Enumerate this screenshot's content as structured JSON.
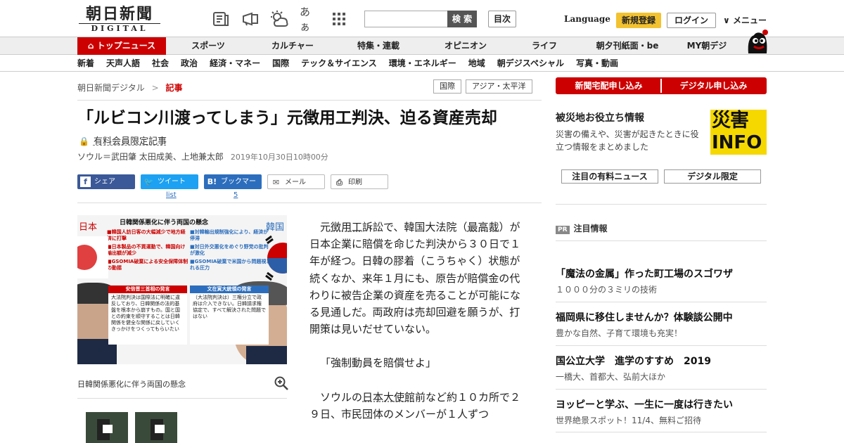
{
  "header": {
    "logo_main": "朝日新聞",
    "logo_sub": "DIGITAL",
    "search_button": "検 索",
    "toc_button": "目次",
    "language": "Language",
    "signup": "新規登録",
    "login": "ログイン",
    "menu": "メニュー",
    "icons": [
      "newspaper-icon",
      "megaphone-icon",
      "weather-icon",
      "font-size-icon",
      "grid-icon"
    ],
    "font_size_glyph": "あぁ"
  },
  "nav_primary": [
    "トップニュース",
    "スポーツ",
    "カルチャー",
    "特集・連載",
    "オピニオン",
    "ライフ",
    "朝夕刊紙面・be",
    "MY朝デジ"
  ],
  "nav_secondary": [
    "新着",
    "天声人語",
    "社会",
    "政治",
    "経済・マネー",
    "国際",
    "テック＆サイエンス",
    "環境・エネルギー",
    "地域",
    "朝デジスペシャル",
    "写真・動画"
  ],
  "breadcrumb": {
    "home": "朝日新聞デジタル",
    "sep": ">",
    "current": "記事"
  },
  "tags": [
    "国際",
    "アジア・太平洋"
  ],
  "article": {
    "headline": "「ルビコン川渡ってしまう」元徴用工判決、迫る資産売却",
    "members_only": "有料会員限定記事",
    "authors": "ソウル＝武田肇 太田成美、上地兼太郎",
    "date": "2019年10月30日10時00分",
    "paragraphs": [
      [
        "元",
        "徴用工",
        "訴訟で、韓国大法院（",
        "最高裁",
        "）が日本企業に賠償を命じた判決から３０日で１年が経つ。日韓の膠着（こうちゃく）状態が続くなか、来年１月にも、原告が賠償金の代わりに被告企業の資産を売ることが可能になる見通しだ。両政府は売却回避を願うが、打開策は見いだせていない。"
      ],
      [
        "「強制動員を賠償せよ」"
      ],
      [
        "ソウルの",
        "日本大使館",
        "前など約１０カ所で２９日、市民団体のメンバーが１人ずつ"
      ]
    ]
  },
  "share": {
    "facebook": "シェア",
    "twitter": "ツイート",
    "twitter_count": "list",
    "hatena": "ブックマーク",
    "hatena_count": "5",
    "mail": "メール",
    "print": "印刷"
  },
  "figure": {
    "title": "日韓関係悪化に伴う両国の懸念",
    "japan": "日本",
    "korea": "韓国",
    "japan_points": [
      "■韓国人訪日客の大幅減少で地方経済に打撃",
      "■日本製品の不買運動で、韓国向け輸出額が減少",
      "■GSOMIA破棄による安全保障体制の動揺"
    ],
    "korea_points": [
      "■対韓輸出規制強化により、経済が停滞",
      "■対日外交悪化をめぐり野党の批判が激化",
      "■GSOMIA破棄で米国から問題視される圧力"
    ],
    "japan_box_head": "安倍晋三首相の発言",
    "japan_box": "大法院判決は国際法に明確に違反しており、日韓関係の法的基盤を根本から崩すもの。国と国との約束を順守することは日韓関係を健全な関係に戻していくきっかけをつくってもらいたい",
    "korea_box_head": "文在寅大統領の発言",
    "korea_box": "（大法院判決は）三権分立で政府は介入できない。日韓請求権協定で、すべて解決された問題ではない",
    "caption": "日韓関係悪化に伴う両国の懸念"
  },
  "sidebar": {
    "apply_home": "新聞宅配申し込み",
    "apply_digital": "デジタル申し込み",
    "disaster_title": "被災地お役立ち情報",
    "disaster_desc": "災害の備えや、災害が起きたときに役立つ情報をまとめました",
    "disaster_logo_top": "災害",
    "disaster_logo_bottom": "INFO",
    "tab_paid": "注目の有料ニュース",
    "tab_digital": "デジタル限定",
    "pr_badge": "PR",
    "pr_title": "注目情報",
    "pr_items": [
      {
        "title": "「魔法の金属」作った町工場のスゴワザ",
        "desc": "１０００分の３ミリの技術"
      },
      {
        "title": "福岡県に移住しませんか？体験談公開中",
        "desc": "豊かな自然、子育て環境も充実！"
      },
      {
        "title": "国公立大学　進学のすすめ　2019",
        "desc": "一橋大、首都大、弘前大ほか"
      },
      {
        "title": "ヨッピーと学ぶ、一生に一度は行きたい",
        "desc": "世界絶景スポット！11/4、無料ご招待"
      }
    ]
  },
  "colors": {
    "brand_red": "#cc0000",
    "signup_yellow": "#f2c230",
    "facebook": "#3b5998",
    "twitter": "#1da1f2",
    "hatena": "#2c6ebd"
  }
}
